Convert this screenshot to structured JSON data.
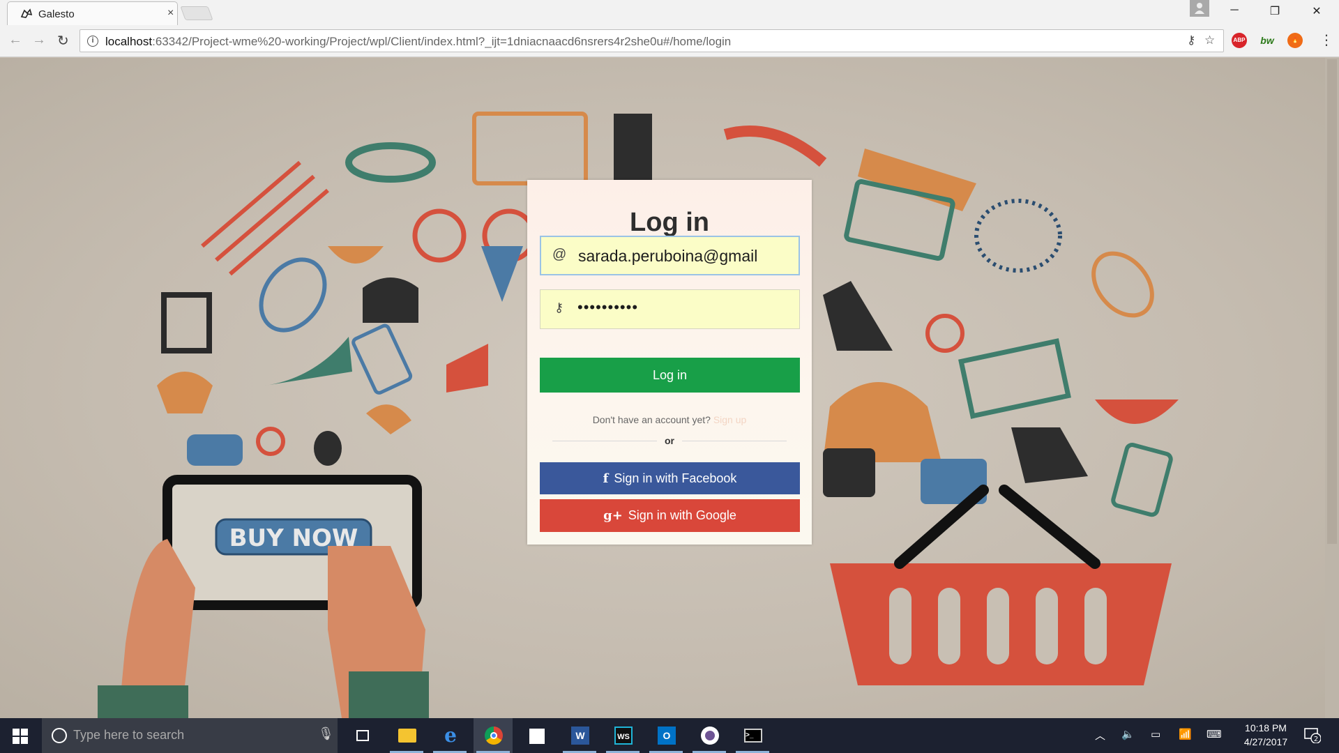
{
  "browser": {
    "tab_title": "Galesto",
    "tab_close": "×",
    "url_host": "localhost",
    "url_rest": ":63342/Project-wme%20-working/Project/wpl/Client/index.html?_ijt=1dniacnaacd6nsrers4r2she0u#/home/login",
    "ext_abp": "ABP",
    "ext_bw": "bw",
    "win_minimize": "─",
    "win_restore": "❐",
    "win_close": "✕"
  },
  "login": {
    "title": "Log in",
    "email_icon": "@",
    "email_value": "sarada.peruboina@gmail",
    "password_icon": "key-icon",
    "password_value": "••••••••••",
    "login_button": "Log in",
    "signup_prompt": "Don't have an account yet?",
    "signup_link": "Sign up",
    "or_label": "or",
    "facebook_button": "Sign in with Facebook",
    "facebook_icon": "f",
    "google_button": "Sign in with Google",
    "google_icon": "g+"
  },
  "background": {
    "buy_now_label": "BUY NOW"
  },
  "taskbar": {
    "search_placeholder": "Type here to search",
    "time": "10:18 PM",
    "date": "4/27/2017",
    "notification_count": "2",
    "word_label": "W",
    "webstorm_label": "WS",
    "outlook_label": "O"
  },
  "colors": {
    "login_button": "#189f48",
    "facebook_button": "#3a589b",
    "google_button": "#d9473a",
    "field_fill": "#fbfdc7",
    "taskbar": "#1c2130"
  }
}
